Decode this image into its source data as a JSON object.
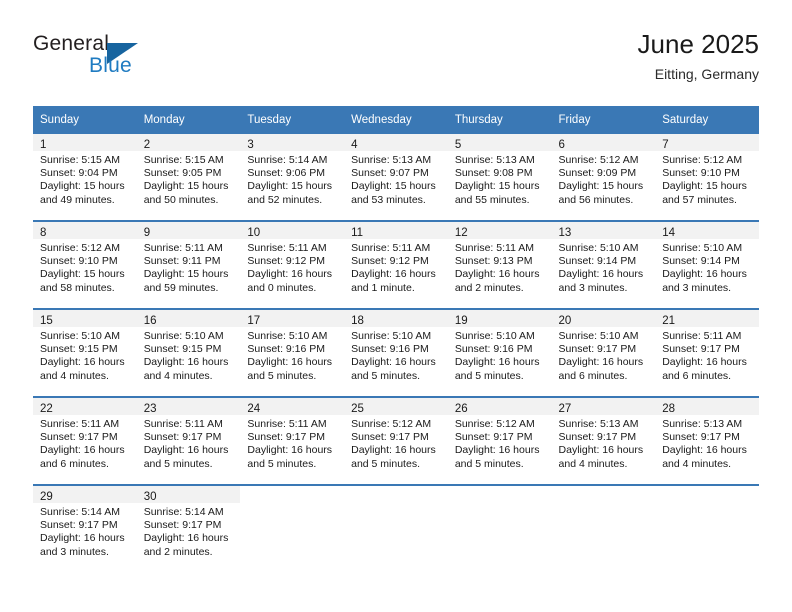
{
  "brand": {
    "word_one": "General",
    "word_two": "Blue",
    "logo_icon": "triangle-flag-icon",
    "accent_color": "#1f7bc1",
    "triangle_color": "#17649f"
  },
  "header": {
    "title": "June 2025",
    "subtitle": "Eitting, Germany"
  },
  "calendar": {
    "header_bg": "#3a78b5",
    "daynum_bg": "#f2f2f2",
    "weekday_headers": [
      "Sunday",
      "Monday",
      "Tuesday",
      "Wednesday",
      "Thursday",
      "Friday",
      "Saturday"
    ],
    "weeks": [
      [
        {
          "day": "1",
          "sunrise": "Sunrise: 5:15 AM",
          "sunset": "Sunset: 9:04 PM",
          "daylight_line1": "Daylight: 15 hours",
          "daylight_line2": "and 49 minutes."
        },
        {
          "day": "2",
          "sunrise": "Sunrise: 5:15 AM",
          "sunset": "Sunset: 9:05 PM",
          "daylight_line1": "Daylight: 15 hours",
          "daylight_line2": "and 50 minutes."
        },
        {
          "day": "3",
          "sunrise": "Sunrise: 5:14 AM",
          "sunset": "Sunset: 9:06 PM",
          "daylight_line1": "Daylight: 15 hours",
          "daylight_line2": "and 52 minutes."
        },
        {
          "day": "4",
          "sunrise": "Sunrise: 5:13 AM",
          "sunset": "Sunset: 9:07 PM",
          "daylight_line1": "Daylight: 15 hours",
          "daylight_line2": "and 53 minutes."
        },
        {
          "day": "5",
          "sunrise": "Sunrise: 5:13 AM",
          "sunset": "Sunset: 9:08 PM",
          "daylight_line1": "Daylight: 15 hours",
          "daylight_line2": "and 55 minutes."
        },
        {
          "day": "6",
          "sunrise": "Sunrise: 5:12 AM",
          "sunset": "Sunset: 9:09 PM",
          "daylight_line1": "Daylight: 15 hours",
          "daylight_line2": "and 56 minutes."
        },
        {
          "day": "7",
          "sunrise": "Sunrise: 5:12 AM",
          "sunset": "Sunset: 9:10 PM",
          "daylight_line1": "Daylight: 15 hours",
          "daylight_line2": "and 57 minutes."
        }
      ],
      [
        {
          "day": "8",
          "sunrise": "Sunrise: 5:12 AM",
          "sunset": "Sunset: 9:10 PM",
          "daylight_line1": "Daylight: 15 hours",
          "daylight_line2": "and 58 minutes."
        },
        {
          "day": "9",
          "sunrise": "Sunrise: 5:11 AM",
          "sunset": "Sunset: 9:11 PM",
          "daylight_line1": "Daylight: 15 hours",
          "daylight_line2": "and 59 minutes."
        },
        {
          "day": "10",
          "sunrise": "Sunrise: 5:11 AM",
          "sunset": "Sunset: 9:12 PM",
          "daylight_line1": "Daylight: 16 hours",
          "daylight_line2": "and 0 minutes."
        },
        {
          "day": "11",
          "sunrise": "Sunrise: 5:11 AM",
          "sunset": "Sunset: 9:12 PM",
          "daylight_line1": "Daylight: 16 hours",
          "daylight_line2": "and 1 minute."
        },
        {
          "day": "12",
          "sunrise": "Sunrise: 5:11 AM",
          "sunset": "Sunset: 9:13 PM",
          "daylight_line1": "Daylight: 16 hours",
          "daylight_line2": "and 2 minutes."
        },
        {
          "day": "13",
          "sunrise": "Sunrise: 5:10 AM",
          "sunset": "Sunset: 9:14 PM",
          "daylight_line1": "Daylight: 16 hours",
          "daylight_line2": "and 3 minutes."
        },
        {
          "day": "14",
          "sunrise": "Sunrise: 5:10 AM",
          "sunset": "Sunset: 9:14 PM",
          "daylight_line1": "Daylight: 16 hours",
          "daylight_line2": "and 3 minutes."
        }
      ],
      [
        {
          "day": "15",
          "sunrise": "Sunrise: 5:10 AM",
          "sunset": "Sunset: 9:15 PM",
          "daylight_line1": "Daylight: 16 hours",
          "daylight_line2": "and 4 minutes."
        },
        {
          "day": "16",
          "sunrise": "Sunrise: 5:10 AM",
          "sunset": "Sunset: 9:15 PM",
          "daylight_line1": "Daylight: 16 hours",
          "daylight_line2": "and 4 minutes."
        },
        {
          "day": "17",
          "sunrise": "Sunrise: 5:10 AM",
          "sunset": "Sunset: 9:16 PM",
          "daylight_line1": "Daylight: 16 hours",
          "daylight_line2": "and 5 minutes."
        },
        {
          "day": "18",
          "sunrise": "Sunrise: 5:10 AM",
          "sunset": "Sunset: 9:16 PM",
          "daylight_line1": "Daylight: 16 hours",
          "daylight_line2": "and 5 minutes."
        },
        {
          "day": "19",
          "sunrise": "Sunrise: 5:10 AM",
          "sunset": "Sunset: 9:16 PM",
          "daylight_line1": "Daylight: 16 hours",
          "daylight_line2": "and 5 minutes."
        },
        {
          "day": "20",
          "sunrise": "Sunrise: 5:10 AM",
          "sunset": "Sunset: 9:17 PM",
          "daylight_line1": "Daylight: 16 hours",
          "daylight_line2": "and 6 minutes."
        },
        {
          "day": "21",
          "sunrise": "Sunrise: 5:11 AM",
          "sunset": "Sunset: 9:17 PM",
          "daylight_line1": "Daylight: 16 hours",
          "daylight_line2": "and 6 minutes."
        }
      ],
      [
        {
          "day": "22",
          "sunrise": "Sunrise: 5:11 AM",
          "sunset": "Sunset: 9:17 PM",
          "daylight_line1": "Daylight: 16 hours",
          "daylight_line2": "and 6 minutes."
        },
        {
          "day": "23",
          "sunrise": "Sunrise: 5:11 AM",
          "sunset": "Sunset: 9:17 PM",
          "daylight_line1": "Daylight: 16 hours",
          "daylight_line2": "and 5 minutes."
        },
        {
          "day": "24",
          "sunrise": "Sunrise: 5:11 AM",
          "sunset": "Sunset: 9:17 PM",
          "daylight_line1": "Daylight: 16 hours",
          "daylight_line2": "and 5 minutes."
        },
        {
          "day": "25",
          "sunrise": "Sunrise: 5:12 AM",
          "sunset": "Sunset: 9:17 PM",
          "daylight_line1": "Daylight: 16 hours",
          "daylight_line2": "and 5 minutes."
        },
        {
          "day": "26",
          "sunrise": "Sunrise: 5:12 AM",
          "sunset": "Sunset: 9:17 PM",
          "daylight_line1": "Daylight: 16 hours",
          "daylight_line2": "and 5 minutes."
        },
        {
          "day": "27",
          "sunrise": "Sunrise: 5:13 AM",
          "sunset": "Sunset: 9:17 PM",
          "daylight_line1": "Daylight: 16 hours",
          "daylight_line2": "and 4 minutes."
        },
        {
          "day": "28",
          "sunrise": "Sunrise: 5:13 AM",
          "sunset": "Sunset: 9:17 PM",
          "daylight_line1": "Daylight: 16 hours",
          "daylight_line2": "and 4 minutes."
        }
      ],
      [
        {
          "day": "29",
          "sunrise": "Sunrise: 5:14 AM",
          "sunset": "Sunset: 9:17 PM",
          "daylight_line1": "Daylight: 16 hours",
          "daylight_line2": "and 3 minutes."
        },
        {
          "day": "30",
          "sunrise": "Sunrise: 5:14 AM",
          "sunset": "Sunset: 9:17 PM",
          "daylight_line1": "Daylight: 16 hours",
          "daylight_line2": "and 2 minutes."
        },
        {
          "day": "",
          "sunrise": "",
          "sunset": "",
          "daylight_line1": "",
          "daylight_line2": ""
        },
        {
          "day": "",
          "sunrise": "",
          "sunset": "",
          "daylight_line1": "",
          "daylight_line2": ""
        },
        {
          "day": "",
          "sunrise": "",
          "sunset": "",
          "daylight_line1": "",
          "daylight_line2": ""
        },
        {
          "day": "",
          "sunrise": "",
          "sunset": "",
          "daylight_line1": "",
          "daylight_line2": ""
        },
        {
          "day": "",
          "sunrise": "",
          "sunset": "",
          "daylight_line1": "",
          "daylight_line2": ""
        }
      ]
    ]
  }
}
